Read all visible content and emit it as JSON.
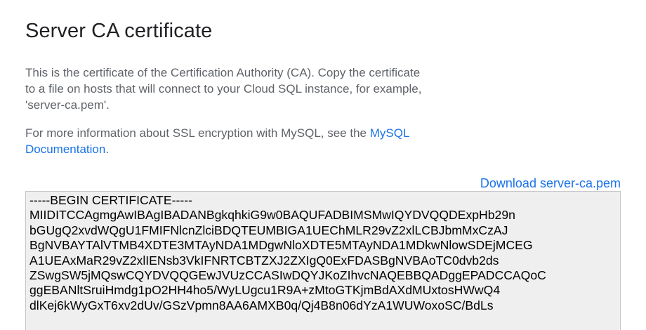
{
  "dialog": {
    "title": "Server CA certificate",
    "description": "This is the certificate of the Certification Authority (CA). Copy the certificate\nto a file on hosts that will connect to your Cloud SQL instance, for example,\n'server-ca.pem'.",
    "more_info_prefix": "For more information about SSL encryption with MySQL, see the ",
    "more_info_link": "MySQL\nDocumentation",
    "more_info_suffix": ".",
    "download_label": "Download server-ca.pem"
  },
  "certificate": {
    "text": "-----BEGIN CERTIFICATE-----\nMIIDITCCAgmgAwIBAgIBADANBgkqhkiG9w0BAQUFADBIMSMwIQYDVQQDExpHb29n\nbGUgQ2xvdWQgU1FMIFNlcnZlciBDQTEUMBIGA1UEChMLR29vZ2xlLCBJbmMxCzAJ\nBgNVBAYTAlVTMB4XDTE3MTAyNDA1MDgwNloXDTE5MTAyNDA1MDkwNlowSDEjMCEG\nA1UEAxMaR29vZ2xlIENsb3VkIFNRTCBTZXJ2ZXIgQ0ExFDASBgNVBAoTC0dvb2ds\nZSwgSW5jMQswCQYDVQQGEwJVUzCCASIwDQYJKoZIhvcNAQEBBQADggEPADCCAQoC\nggEBANltSruiHmdg1pO2HH4ho5/WyLUgcu1R9A+zMtoGTKjmBdAXdMUxtosHWwQ4\ndlKej6kWyGxT6xv2dUv/GSzVpmn8AA6AMXB0q/Qj4B8n06dYzA1WUWoxoSC/BdLs"
  }
}
